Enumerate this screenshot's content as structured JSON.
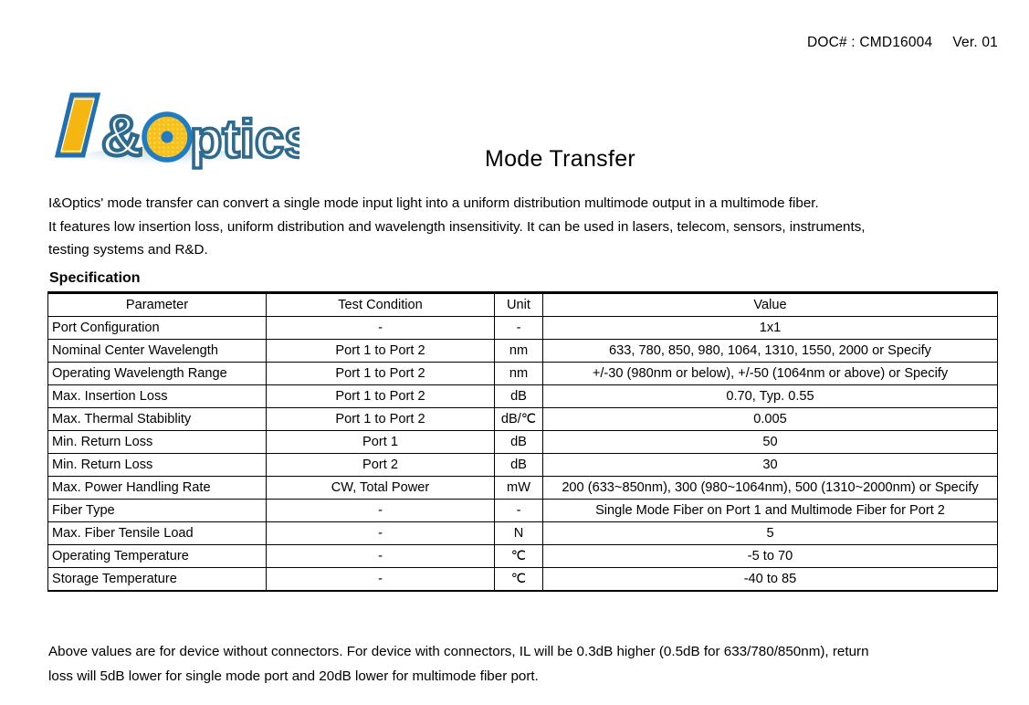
{
  "header": {
    "doc_number": "DOC# : CMD16004",
    "version": "Ver. 01"
  },
  "logo": {
    "alt": "I&Optics",
    "letter_i": "I",
    "ampersand": "&",
    "word": "ptics",
    "colors": {
      "gold": "#F5B612",
      "blue": "#1F6FB5",
      "outline_blue": "#2E6A8E",
      "dot_blue": "#1F7BC4"
    }
  },
  "title": "Mode Transfer",
  "intro": {
    "line1": "I&Optics' mode transfer can convert a single mode input light into a uniform distribution multimode output in a multimode fiber.",
    "line2": "It features low insertion loss, uniform distribution and wavelength insensitivity. It can be used in lasers, telecom, sensors, instruments,",
    "line3": "testing systems and R&D."
  },
  "spec_label": "Specification",
  "table": {
    "columns": [
      "Parameter",
      "Test Condition",
      "Unit",
      "Value"
    ],
    "rows": [
      {
        "parameter": "Port Configuration",
        "condition": "-",
        "unit": "-",
        "value": "1x1"
      },
      {
        "parameter": "Nominal Center Wavelength",
        "condition": "Port 1 to Port 2",
        "unit": "nm",
        "value": "633, 780, 850, 980, 1064, 1310, 1550, 2000 or Specify"
      },
      {
        "parameter": "Operating Wavelength Range",
        "condition": "Port 1 to Port 2",
        "unit": "nm",
        "value": "+/-30 (980nm or below), +/-50 (1064nm or above) or Specify"
      },
      {
        "parameter": "Max. Insertion Loss",
        "condition": "Port 1 to Port 2",
        "unit": "dB",
        "value": "0.70, Typ. 0.55"
      },
      {
        "parameter": "Max. Thermal Stabiblity",
        "condition": "Port 1 to Port 2",
        "unit": "dB/℃",
        "value": "0.005"
      },
      {
        "parameter": "Min. Return Loss",
        "condition": "Port 1",
        "unit": "dB",
        "value": "50"
      },
      {
        "parameter": "Min. Return Loss",
        "condition": "Port 2",
        "unit": "dB",
        "value": "30"
      },
      {
        "parameter": "Max. Power Handling Rate",
        "condition": "CW, Total Power",
        "unit": "mW",
        "value": "200 (633~850nm), 300 (980~1064nm), 500 (1310~2000nm) or Specify",
        "tall": true
      },
      {
        "parameter": "Fiber Type",
        "condition": "-",
        "unit": "-",
        "value": "Single Mode Fiber on Port 1 and Multimode Fiber for Port 2"
      },
      {
        "parameter": "Max. Fiber Tensile Load",
        "condition": "-",
        "unit": "N",
        "value": "5"
      },
      {
        "parameter": "Operating Temperature",
        "condition": "-",
        "unit": "℃",
        "value": "-5 to 70"
      },
      {
        "parameter": "Storage Temperature",
        "condition": "-",
        "unit": "℃",
        "value": "-40 to 85"
      }
    ]
  },
  "footnote": {
    "line1": "Above values are for device without connectors. For device with connectors, IL will be 0.3dB higher (0.5dB for 633/780/850nm), return",
    "line2": "loss will 5dB lower for single mode port and 20dB lower for multimode fiber port."
  }
}
